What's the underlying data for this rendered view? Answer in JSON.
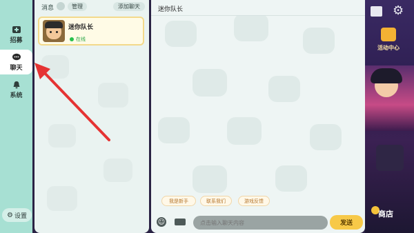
{
  "nav": {
    "items": [
      {
        "id": "recruit",
        "label": "招募"
      },
      {
        "id": "chat",
        "label": "聊天"
      },
      {
        "id": "system",
        "label": "系统"
      }
    ],
    "settings_label": "设置"
  },
  "list": {
    "title": "消息",
    "manage_label": "管理",
    "add_chat_label": "添加聊天",
    "contact": {
      "name": "迷你队长",
      "status": "在线"
    }
  },
  "chat": {
    "title": "迷你队长",
    "quick_replies": [
      "我是新手",
      "联系我们",
      "游戏反馈"
    ],
    "input_placeholder": "点击输入聊天内容",
    "send_label": "发送"
  },
  "game": {
    "event_label": "活动中心",
    "shop_label": "商店"
  },
  "colors": {
    "nav_bg": "#a7e0d3",
    "accent_yellow": "#f7c948",
    "online": "#27c14c",
    "arrow": "#e53333"
  }
}
